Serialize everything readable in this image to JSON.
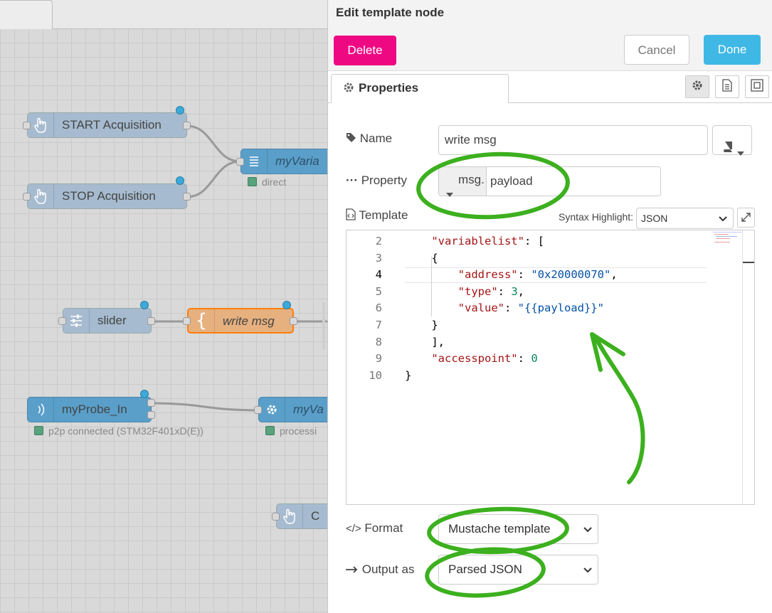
{
  "workspace": {
    "nodes": {
      "start": "START Acquisition",
      "stop": "STOP Acquisition",
      "variable": "myVaria",
      "variable_status": "direct",
      "slider": "slider",
      "template": "write msg",
      "probe": "myProbe_In",
      "probe_status": "p2p connected (STM32F401xD(E))",
      "processor": "myVa",
      "processor_status": "processi",
      "inject_partial": "C"
    }
  },
  "tray": {
    "title": "Edit template node",
    "delete_label": "Delete",
    "cancel_label": "Cancel",
    "done_label": "Done",
    "tab_label": "Properties"
  },
  "form": {
    "name_label": "Name",
    "name_value": "write msg",
    "property_label": "Property",
    "property_prefix": "msg.",
    "property_value": "payload",
    "template_label": "Template",
    "syntax_label": "Syntax Highlight:",
    "syntax_value": "JSON",
    "format_label": "Format",
    "format_value": "Mustache template",
    "output_label": "Output as",
    "output_value": "Parsed JSON"
  },
  "code": [
    {
      "num": "2",
      "indent": "    ",
      "parts": [
        {
          "t": "\"variablelist\"",
          "c": "k"
        },
        {
          "t": ": [",
          "c": "p"
        }
      ]
    },
    {
      "num": "3",
      "indent": "    ",
      "parts": [
        {
          "t": "{",
          "c": "p"
        }
      ]
    },
    {
      "num": "4",
      "indent": "        ",
      "parts": [
        {
          "t": "\"address\"",
          "c": "k"
        },
        {
          "t": ": ",
          "c": "p"
        },
        {
          "t": "\"0x20000070\"",
          "c": "s"
        },
        {
          "t": ",",
          "c": "p"
        }
      ]
    },
    {
      "num": "5",
      "indent": "        ",
      "parts": [
        {
          "t": "\"type\"",
          "c": "k"
        },
        {
          "t": ": ",
          "c": "p"
        },
        {
          "t": "3",
          "c": "n"
        },
        {
          "t": ",",
          "c": "p"
        }
      ]
    },
    {
      "num": "6",
      "indent": "        ",
      "parts": [
        {
          "t": "\"value\"",
          "c": "k"
        },
        {
          "t": ": ",
          "c": "p"
        },
        {
          "t": "\"{{payload}}\"",
          "c": "s"
        }
      ]
    },
    {
      "num": "7",
      "indent": "    ",
      "parts": [
        {
          "t": "}",
          "c": "p"
        }
      ]
    },
    {
      "num": "8",
      "indent": "    ",
      "parts": [
        {
          "t": "],",
          "c": "p"
        }
      ]
    },
    {
      "num": "9",
      "indent": "    ",
      "parts": [
        {
          "t": "\"accesspoint\"",
          "c": "k"
        },
        {
          "t": ": ",
          "c": "p"
        },
        {
          "t": "0",
          "c": "n"
        }
      ]
    },
    {
      "num": "10",
      "indent": "",
      "parts": [
        {
          "t": "}",
          "c": "p"
        }
      ]
    }
  ],
  "colors": {
    "delete": "#ee0983",
    "done": "#3fb8e6",
    "template_node": "#e6b07f",
    "annotation": "#3cb01e"
  },
  "icons": [
    "hand-pointer-icon",
    "list-icon",
    "sliders-icon",
    "brace-icon",
    "signal-icon",
    "gear-icon",
    "tag-icon",
    "ellipsis-icon",
    "file-code-icon",
    "code-icon",
    "arrow-right-icon",
    "book-icon",
    "document-icon",
    "frame-icon",
    "expand-icon",
    "caret-down-icon",
    "chevron-down-icon"
  ]
}
